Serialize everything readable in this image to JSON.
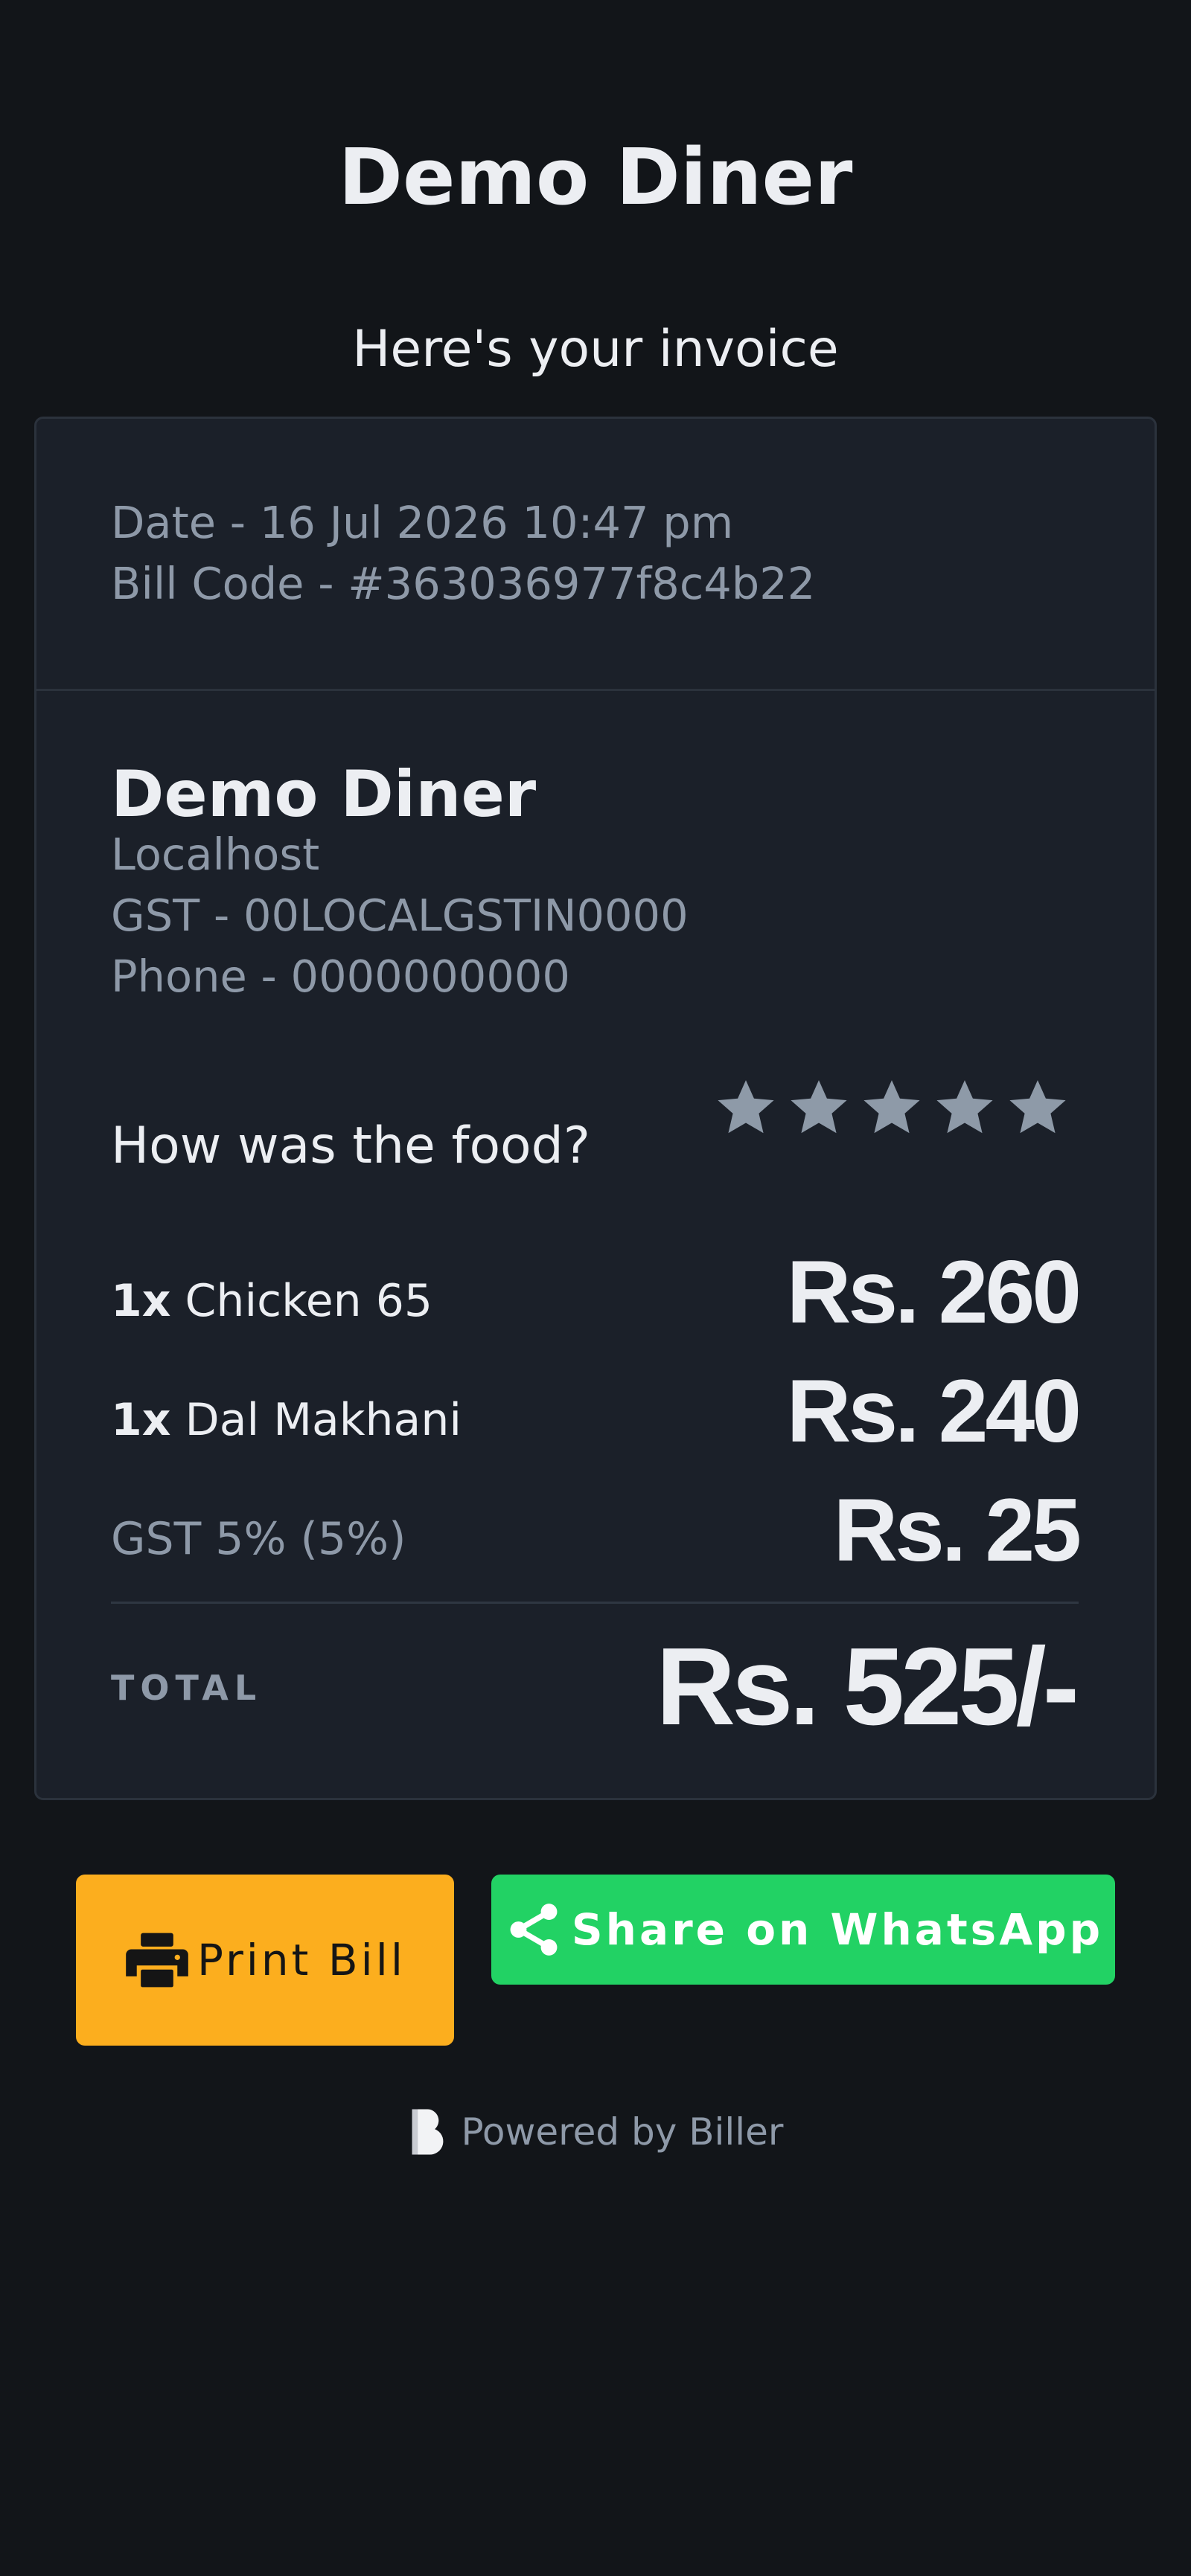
{
  "header": {
    "shop_name": "Demo Diner",
    "subtitle": "Here's your invoice"
  },
  "meta": {
    "date": "Date - 16 Jul 2026 10:47 pm",
    "bill_code": "Bill Code - #363036977f8c4b22"
  },
  "store": {
    "name": "Demo Diner",
    "address": "Localhost",
    "gst": "GST - 00LOCALGSTIN0000",
    "phone": "Phone - 0000000000"
  },
  "rating": {
    "question": "How was the food?",
    "max_stars": 5,
    "value": 0,
    "star_color": "#8e9aa8"
  },
  "items": [
    {
      "qty": "1x",
      "name": "Chicken 65",
      "price": "Rs. 260"
    },
    {
      "qty": "1x",
      "name": "Dal Makhani",
      "price": "Rs. 240"
    }
  ],
  "tax": {
    "label": "GST 5% (5%)",
    "amount": "Rs. 25"
  },
  "total": {
    "label": "TOTAL",
    "value": "Rs. 525/-"
  },
  "actions": {
    "print_label": "Print Bill",
    "print_icon": "printer-icon",
    "print_color": "#fcae1e",
    "share_label": "Share on WhatsApp",
    "share_icon": "share-icon",
    "share_color": "#22d264"
  },
  "footer": {
    "powered_by": "Powered by Biller",
    "logo_icon": "biller-logo-icon"
  }
}
